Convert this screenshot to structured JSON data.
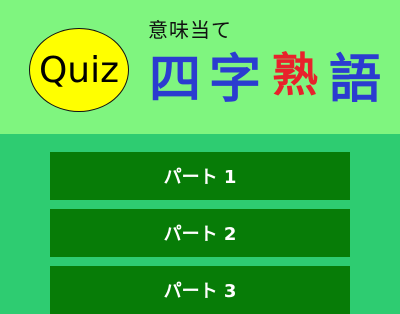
{
  "header": {
    "badge_label": "Quiz",
    "subtitle": "意味当て",
    "title_chars": [
      "四",
      "字",
      "熟",
      "語"
    ]
  },
  "colors": {
    "header_bg": "#7ff57f",
    "body_bg": "#2ecc71",
    "badge_fill": "#ffff00",
    "title_blue": "#2b3cd0",
    "title_red": "#e8212b",
    "button_bg": "#077c07",
    "button_text": "#ffffff"
  },
  "parts": [
    {
      "label": "パート 1"
    },
    {
      "label": "パート 2"
    },
    {
      "label": "パート 3"
    }
  ]
}
